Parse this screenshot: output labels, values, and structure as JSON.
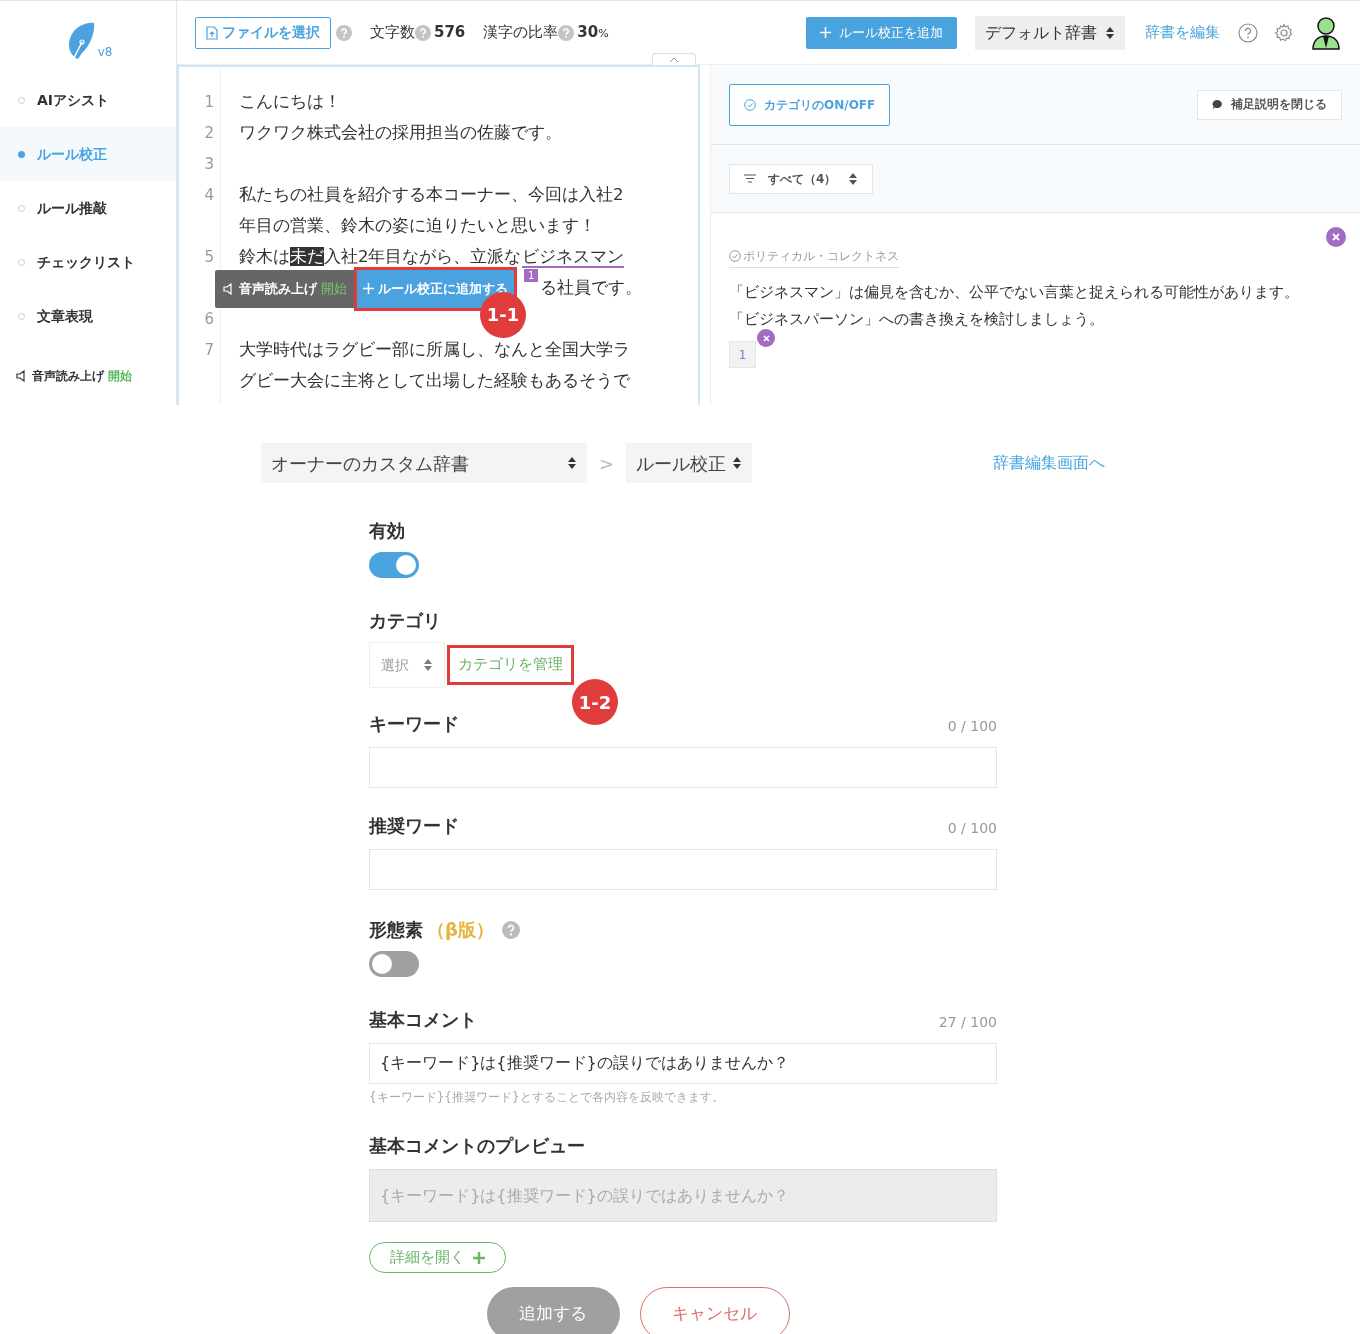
{
  "sidebar": {
    "logo_version": "v8",
    "items": [
      {
        "label": "AIアシスト",
        "selected": false
      },
      {
        "label": "ルール校正",
        "selected": true
      },
      {
        "label": "ルール推敲",
        "selected": false
      },
      {
        "label": "チェックリスト",
        "selected": false
      },
      {
        "label": "文章表現",
        "selected": false
      }
    ],
    "voice": {
      "label": "音声読み上げ",
      "action": "開始"
    }
  },
  "toolbar": {
    "file_button": "ファイルを選択",
    "char_count_label": "文字数",
    "char_count": "576",
    "kanji_label": "漢字の比率",
    "kanji_value": "30",
    "kanji_unit": "%",
    "add_rule_button": "ルール校正を追加",
    "dictionary_select": "デフォルト辞書",
    "edit_dictionary_link": "辞書を編集"
  },
  "editor": {
    "lines": [
      {
        "number": "1",
        "rows": [
          [
            {
              "kind": "plain",
              "text": "こんにちは！"
            }
          ]
        ]
      },
      {
        "number": "2",
        "rows": [
          [
            {
              "kind": "plain",
              "text": "ワクワク株式会社の採用担当の佐藤です。"
            }
          ]
        ]
      },
      {
        "number": "3"
      },
      {
        "number": "4",
        "rows": [
          [
            {
              "kind": "plain",
              "text": "私たちの社員を紹介する本コーナー、今回は入社2"
            }
          ],
          [
            {
              "kind": "plain",
              "text": "年目の営業、鈴木の姿に迫りたいと思います！"
            }
          ]
        ]
      },
      {
        "number": "5",
        "rows": [
          [
            {
              "kind": "plain",
              "text": "鈴木は"
            },
            {
              "kind": "highlight",
              "text": "未だ"
            },
            {
              "kind": "plain",
              "text": "入社2年目ながら、立派な"
            },
            {
              "kind": "flagged",
              "text": "ビジネスマン"
            }
          ]
        ],
        "popup_row": {
          "badge": "1",
          "text": "る社員です。"
        }
      },
      {
        "number": "6"
      },
      {
        "number": "7",
        "rows": [
          [
            {
              "kind": "plain",
              "text": "大学時代はラグビー部に所属し、なんと全国大学ラ"
            }
          ],
          [
            {
              "kind": "plain",
              "text": "グビー大会に主将として出場した経験もあるそうで"
            }
          ]
        ]
      }
    ],
    "popup": {
      "voice_label": "音声読み上げ",
      "voice_action": "開始",
      "add_button": "ルール校正に追加する",
      "annotation": "1-1"
    }
  },
  "suggestions": {
    "category_toggle_button": "カテゴリのON/OFF",
    "close_notes_button": "補足説明を閉じる",
    "filter": "すべて（4）",
    "card": {
      "category": "ポリティカル・コレクトネス",
      "message_lines": [
        "「ビジネスマン」は偏見を含むか、公平でない言葉と捉えられる可能性があります。",
        "「ビジネスパーソン」への書き換えを検討しましょう。"
      ],
      "occurrence": "1"
    }
  },
  "form": {
    "dictionary_select": "オーナーのカスタム辞書",
    "separator": ">",
    "type_select": "ルール校正",
    "edit_screen_link": "辞書編集画面へ",
    "enabled": {
      "label": "有効",
      "on": true
    },
    "category": {
      "label": "カテゴリ",
      "select": "選択",
      "manage_link": "カテゴリを管理",
      "annotation": "1-2"
    },
    "keyword": {
      "label": "キーワード",
      "counter": "0 / 100"
    },
    "recommended": {
      "label": "推奨ワード",
      "counter": "0 / 100"
    },
    "morpheme": {
      "label": "形態素",
      "beta": "（β版）",
      "on": false
    },
    "comment": {
      "label": "基本コメント",
      "counter": "27 / 100",
      "value": "{キーワード}は{推奨ワード}の誤りではありませんか？",
      "hint": "{キーワード}{推奨ワード}とすることで各内容を反映できます。"
    },
    "preview": {
      "label": "基本コメントのプレビュー",
      "value": "{キーワード}は{推奨ワード}の誤りではありませんか？"
    },
    "details_button": "詳細を開く",
    "submit": {
      "label": "追加する",
      "disabled": true
    },
    "cancel": "キャンセル"
  }
}
